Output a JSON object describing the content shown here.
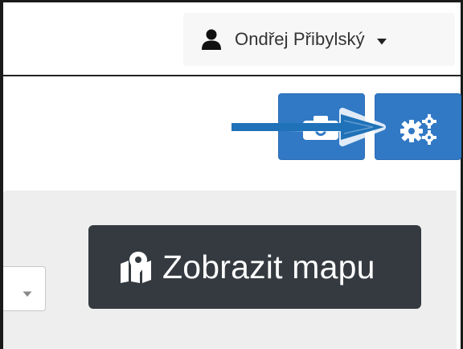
{
  "user_menu": {
    "name": "Ondřej Přibylský",
    "icon": "user-icon",
    "caret_icon": "caret-down-icon"
  },
  "toolbar": {
    "buttons": [
      {
        "icon": "camera-icon"
      },
      {
        "icon": "gears-icon"
      }
    ],
    "accent_color": "#3179c5"
  },
  "annotation": {
    "type": "arrow",
    "color": "#1f72b8",
    "target": "gears-button"
  },
  "filter_panel": {
    "select": {
      "icon": "chevron-down-icon"
    },
    "map_button": {
      "label": "Zobrazit mapu",
      "icon": "map-marker-icon",
      "color": "#343a40"
    }
  }
}
